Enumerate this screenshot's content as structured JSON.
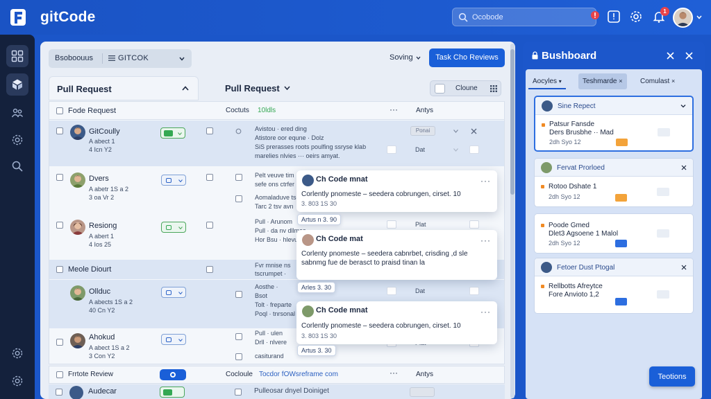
{
  "app": {
    "title": "gitCode"
  },
  "header": {
    "search_placeholder": "Ocobode",
    "badge_left": "1",
    "badge_right": "1"
  },
  "toolbar": {
    "project_a": "Bsoboouus",
    "project_b": "GITCOK",
    "sort_label": "Soving",
    "primary_button": "Task Cho Reviews"
  },
  "columns": {
    "left_title": "Pull Request",
    "right_title": "Pull Request",
    "view_label": "Cloune"
  },
  "table": {
    "header_left": "Fode Request",
    "header_mid": "Coctuts",
    "header_mid_accent": "10ldls",
    "header_right": "Antys",
    "rows": [
      {
        "name": "GitCoully",
        "meta1": "A abect 1",
        "meta2": "4 Icn Y2",
        "mid1": "Avistou · ered ding",
        "mid2": "Atistore oor equne · Dolz",
        "mid3": "SiS prerasses roots poulfing ssryse klab",
        "mid4": "marelies nlvies ··· oeirs amyat.",
        "tag": "Ponai",
        "dat": "Dat"
      },
      {
        "name": "Dvers",
        "meta1": "A abetr 1S a 2",
        "meta2": "3 oa Vr 2",
        "mid1": "Pelt veuve tim",
        "mid2": "sefe ons ctrfer uta",
        "mid3": "Aomaladuve tse",
        "mid4": "Tarc 2 tsv avn"
      },
      {
        "name": "Resiong",
        "meta1": "A abert 1",
        "meta2": "4 Ios 25",
        "mid1": "Pull · Arunom",
        "mid2": "Pull · da nv dllmes",
        "mid3": "Hor Bsu · hlevue",
        "mid4": "",
        "dat": "Plat"
      },
      {
        "name": "Meole Diourt",
        "mid1": "Fvr mnise ns",
        "mid2": "tscrumpet ·",
        "mid3": ""
      },
      {
        "name": "Ollduc",
        "meta1": "A abects 1S a 2",
        "meta2": "40 Cn Y2",
        "mid1": "Aosthe ·",
        "mid2": "Bsot",
        "mid3": "Tolt · freparte",
        "mid4": "Poql · tnrsonal",
        "dat": "Dat"
      },
      {
        "name": "Ahokud",
        "meta1": "A abect 1S a 2",
        "meta2": "3 Con Y2",
        "mid1": "Pull · ulen",
        "mid2": "Drll · nlvere",
        "mid3": "casiturand",
        "dat": "Plat"
      }
    ],
    "footer_label": "Frrtote Review",
    "footer_mid": "Cocloule",
    "footer_mid_link": "Tocdor fOWsreframe com",
    "footer_right": "Antys",
    "last_name": "Audecar",
    "last_mid": "Pulleosar dnyel Doiniget"
  },
  "popovers": [
    {
      "title": "Ch Code mnat",
      "body": "Corlently pnomeste – seedera cobrungen, cirset. 10",
      "meta": "3. 803 1S 30"
    },
    {
      "title": "Ch Code mat",
      "body": "Corlenty pnomeste – seedera cabnrbet, crisding ,d sle sabnmg fue de berasct to praisd tinan la",
      "meta": ""
    },
    {
      "title": "Ch Code mnat",
      "body": "Corlently pnomeste – seedera cobrungen, cirset. 10",
      "meta": "3. 803 1S 30"
    }
  ],
  "tips": [
    "Artus n 3. 90",
    "Arles 3. 30",
    "Artus 3. 30"
  ],
  "dashboard": {
    "title": "Bushboard",
    "tabs": [
      "Aocyles",
      "Teshmarde",
      "Comulast"
    ],
    "cards": [
      {
        "title": "Sine Repect",
        "line1": "Patsur Fansde",
        "line2": "Ders Brusbhe ·· Mad",
        "date": "2dh Syo 12"
      },
      {
        "title": "Fervat Prorloed",
        "line1": "Rotoo Dshate 1",
        "date": "2dh Syo 12"
      },
      {
        "title": "",
        "line1": "Poode Gmed",
        "line2": "Dlet3 Agsoene 1 Malol",
        "date": "2dh Syo 12"
      },
      {
        "title": "Fetoer Dust Ptogal",
        "line1": "Rellbotts Afreytce",
        "line2": "Fore Anvioto 1,2"
      }
    ],
    "button": "Teotions"
  }
}
